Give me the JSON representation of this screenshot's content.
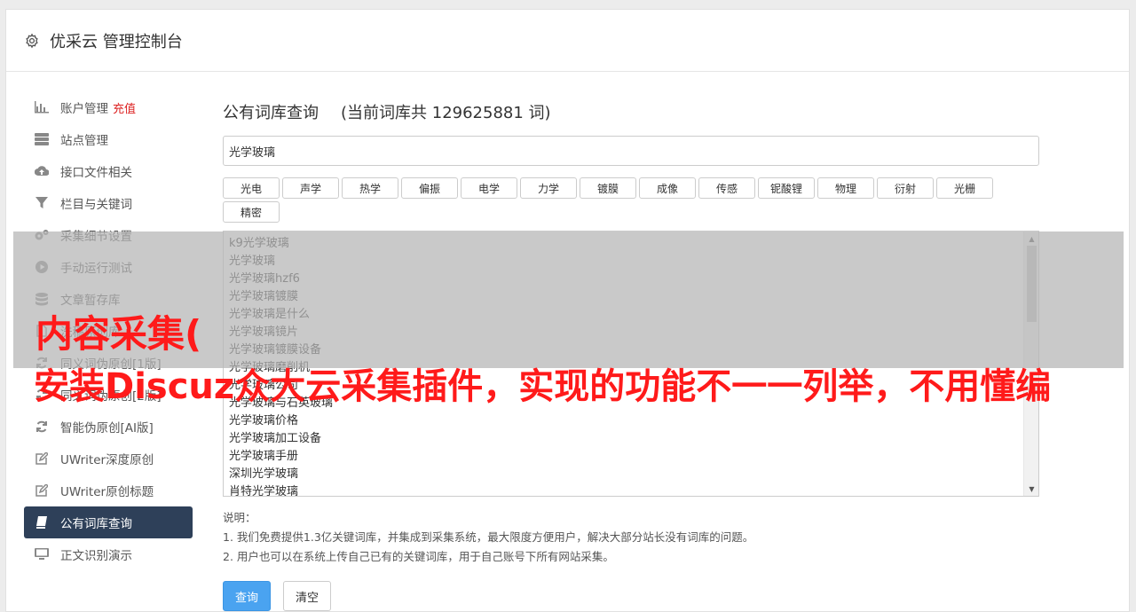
{
  "app": {
    "title": "优采云 管理控制台"
  },
  "sidebar": {
    "items": [
      {
        "label": "账户管理",
        "extra": "充值",
        "icon": "bar-chart-icon"
      },
      {
        "label": "站点管理",
        "icon": "server-icon"
      },
      {
        "label": "接口文件相关",
        "icon": "cloud-upload-icon"
      },
      {
        "label": "栏目与关键词",
        "icon": "filter-icon"
      },
      {
        "label": "采集细节设置",
        "icon": "gears-icon"
      },
      {
        "label": "手动运行测试",
        "icon": "play-circle-icon"
      },
      {
        "label": "文章暂存库",
        "icon": "database-icon"
      },
      {
        "label": "洗稿原创库",
        "icon": "file-icon"
      },
      {
        "label": "同义词伪原创[1版]",
        "icon": "refresh-icon"
      },
      {
        "label": "同义词伪原创[2版]",
        "icon": "refresh-icon"
      },
      {
        "label": "智能伪原创[AI版]",
        "icon": "refresh-icon"
      },
      {
        "label": "UWriter深度原创",
        "icon": "edit-icon"
      },
      {
        "label": "UWriter原创标题",
        "icon": "edit-icon"
      },
      {
        "label": "公有词库查询",
        "icon": "book-icon",
        "active": true
      },
      {
        "label": "正文识别演示",
        "icon": "monitor-icon"
      }
    ]
  },
  "main": {
    "heading": "公有词库查询",
    "count_text": "(当前词库共 129625881 词)",
    "search_value": "光学玻璃",
    "tags": [
      "光电",
      "声学",
      "热学",
      "偏振",
      "电学",
      "力学",
      "镀膜",
      "成像",
      "传感",
      "铌酸锂",
      "物理",
      "衍射",
      "光栅",
      "精密"
    ],
    "words": [
      "k9光学玻璃",
      "光学玻璃",
      "光学玻璃hzf6",
      "光学玻璃镀膜",
      "光学玻璃是什么",
      "光学玻璃镜片",
      "光学玻璃镀膜设备",
      "光学玻璃磨削机",
      "光学玻璃公司",
      "光学玻璃与石英玻璃",
      "光学玻璃价格",
      "光学玻璃加工设备",
      "光学玻璃手册",
      "深圳光学玻璃",
      "肖特光学玻璃"
    ],
    "notes_title": "说明：",
    "notes": [
      "1. 我们免费提供1.3亿关键词库，并集成到采集系统，最大限度方便用户，解决大部分站长没有词库的问题。",
      "2. 用户也可以在系统上传自己已有的关键词库，用于自己账号下所有网站采集。"
    ],
    "query_button": "查询",
    "clear_button": "清空"
  },
  "overlay": {
    "line1": "内容采集(",
    "line2": "安装Discuz众大云采集插件，实现的功能不一一列举，不用懂编"
  }
}
